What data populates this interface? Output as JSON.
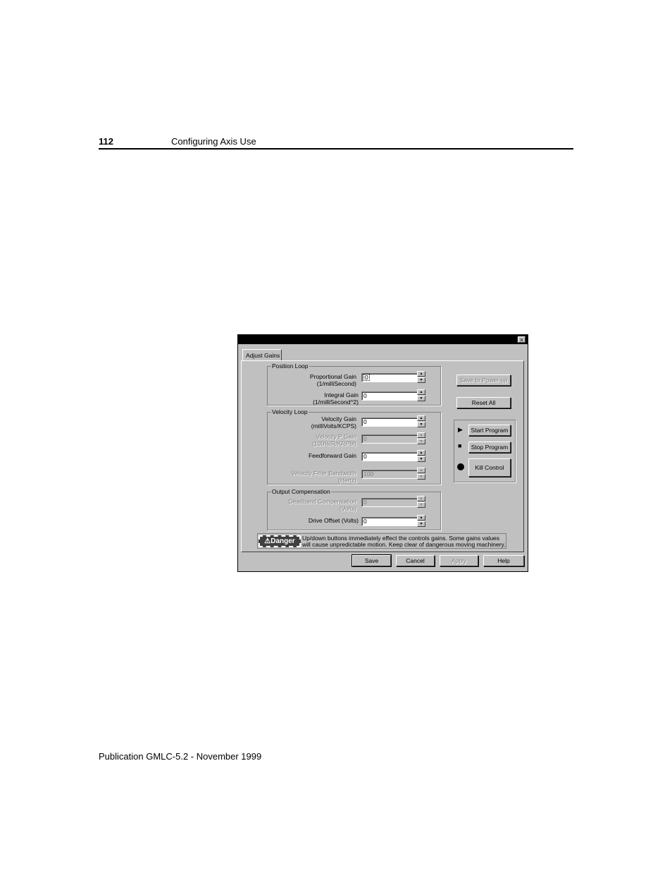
{
  "page": {
    "number": "112",
    "title": "Configuring Axis Use",
    "footer": "Publication GMLC-5.2 - November 1999"
  },
  "dialog": {
    "close_label": "×",
    "tab_label": "Adjust Gains",
    "position_loop": {
      "title": "Position Loop",
      "proportional": {
        "label_1": "Proportional Gain",
        "label_2": "(1/milliSecond)",
        "value": "0"
      },
      "integral": {
        "label_1": "Integral Gain",
        "label_2": "(1/milliSecond^2)",
        "value": "0"
      }
    },
    "velocity_loop": {
      "title": "Velocity Loop",
      "velocity_gain": {
        "label_1": "Velocity Gain",
        "label_2": "(milliVolts/KCPS)",
        "value": "0"
      },
      "velocity_p_gain": {
        "label_1": "Velocity P Gain",
        "label_2": "(100%IR/KRPM)",
        "value": "0"
      },
      "feedforward": {
        "label_1": "Feedforward Gain",
        "value": "0"
      },
      "filter_bandwidth": {
        "label_1": "Velocity Filter Bandwidth",
        "label_2": "(Hertz)",
        "value": "100"
      }
    },
    "output_compensation": {
      "title": "Output Compensation",
      "deadband": {
        "label_1": "Deadband Compensation",
        "label_2": "(Volts)",
        "value": "0"
      },
      "drive_offset": {
        "label_1": "Drive Offset (Volts)",
        "value": "0"
      }
    },
    "spin_up": "▲",
    "spin_down": "▼",
    "save_power_up": "Save to Power-up",
    "reset_all": "Reset All",
    "start_program": "Start Program",
    "stop_program": "Stop Program",
    "kill_control": "Kill Control",
    "start_icon": "▶",
    "stop_icon": "■",
    "danger_badge": "⚠Danger",
    "danger_text": "Up/down buttons immediately effect the controls gains. Some gains values will cause unpredictable motion. Keep clear of dangerous moving machinery.",
    "save": "Save",
    "cancel": "Cancel",
    "apply": "Apply",
    "help": "Help"
  }
}
